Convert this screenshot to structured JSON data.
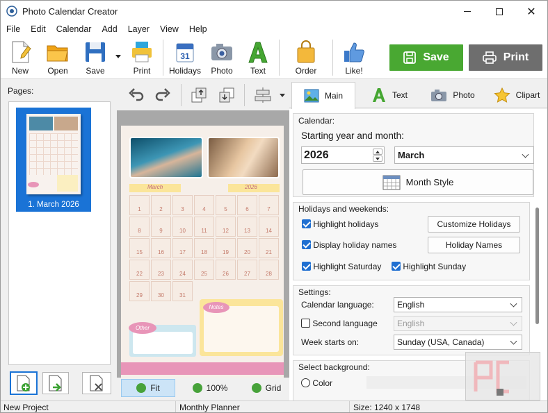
{
  "window": {
    "title": "Photo Calendar Creator"
  },
  "menu": [
    "File",
    "Edit",
    "Calendar",
    "Add",
    "Layer",
    "View",
    "Help"
  ],
  "toolbar": {
    "new": "New",
    "open": "Open",
    "save": "Save",
    "print": "Print",
    "holidays": "Holidays",
    "photo": "Photo",
    "text": "Text",
    "order": "Order",
    "like": "Like!",
    "save_big": "Save",
    "print_big": "Print",
    "holidays_icon_num": "31"
  },
  "left": {
    "pages_label": "Pages:",
    "page1_label": "1. March 2026"
  },
  "preview": {
    "month_left": "March",
    "year_right": "2026",
    "days": [
      "1",
      "2",
      "3",
      "4",
      "5",
      "6",
      "7",
      "8",
      "9",
      "10",
      "11",
      "12",
      "13",
      "14",
      "15",
      "16",
      "17",
      "18",
      "19",
      "20",
      "21",
      "22",
      "23",
      "24",
      "25",
      "26",
      "27",
      "28",
      "29",
      "30",
      "31"
    ],
    "notes_label": "Notes",
    "other_label": "Other"
  },
  "zoom": {
    "fit": "Fit",
    "pct": "100%",
    "grid": "Grid"
  },
  "tabs": [
    "Main",
    "Text",
    "Photo",
    "Clipart"
  ],
  "calendar": {
    "group": "Calendar:",
    "start_label": "Starting year and month:",
    "year": "2026",
    "month": "March",
    "month_style": "Month Style"
  },
  "holidays": {
    "group": "Holidays and weekends:",
    "highlight_holidays": "Highlight holidays",
    "display_names": "Display holiday names",
    "highlight_sat": "Highlight Saturday",
    "highlight_sun": "Highlight Sunday",
    "customize": "Customize Holidays",
    "holiday_names": "Holiday Names"
  },
  "settings": {
    "group": "Settings:",
    "cal_lang_label": "Calendar language:",
    "cal_lang": "English",
    "second_lang_label": "Second language",
    "second_lang": "English",
    "week_starts_label": "Week starts on:",
    "week_starts": "Sunday (USA, Canada)"
  },
  "background": {
    "group": "Select background:",
    "color": "Color"
  },
  "status": {
    "project": "New Project",
    "template": "Monthly Planner",
    "size": "Size: 1240 x 1748"
  },
  "colors": {
    "save_green": "#49a832",
    "print_gray": "#6e6e6e",
    "selection_blue": "#1a73d6",
    "accent_pink": "#e895b8",
    "accent_yellow": "#fbe59a"
  }
}
